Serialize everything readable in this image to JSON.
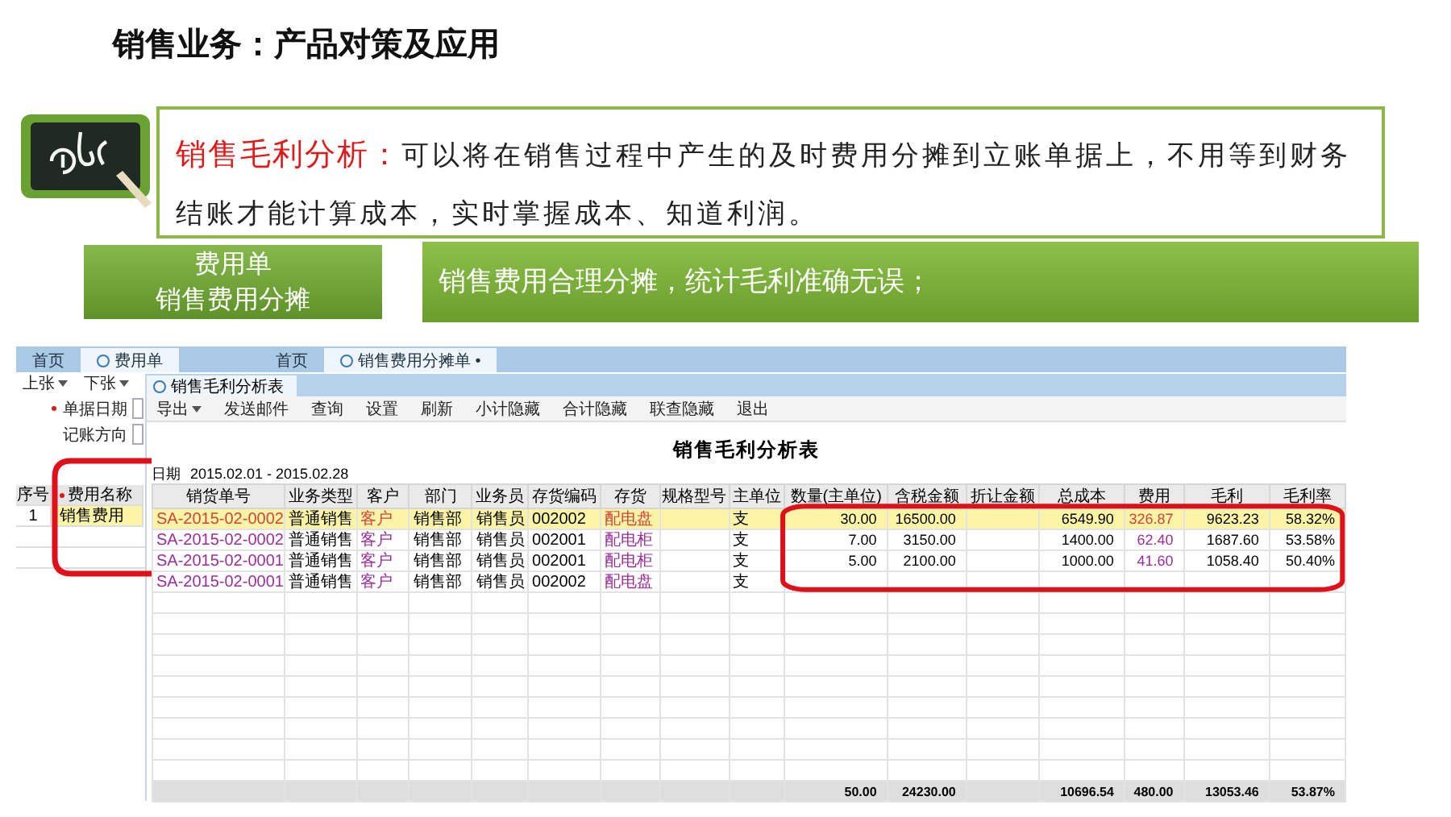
{
  "slide_title": "销售业务：产品对策及应用",
  "intro": {
    "term": "销售毛利分析：",
    "text": "可以将在销售过程中产生的及时费用分摊到立账单据上，不用等到财务结账才能计算成本，实时掌握成本、知道利润。"
  },
  "callouts": [
    {
      "kind": "label",
      "lines": [
        "费用单",
        "销售费用分摊"
      ]
    },
    {
      "kind": "banner",
      "lines": [
        "销售费用合理分摊，统计毛利准确无误；"
      ]
    }
  ],
  "screenshot": {
    "tab_groups": [
      [
        {
          "label": "首页",
          "kind": "home",
          "selected": false
        },
        {
          "label": "费用单",
          "kind": "doc",
          "selected": true
        }
      ],
      [
        {
          "label": "首页",
          "kind": "home",
          "selected": false
        },
        {
          "label": "销售费用分摊单 •",
          "kind": "doc",
          "selected": true
        }
      ]
    ],
    "expense_form": {
      "toolbar": [
        {
          "label": "上张",
          "dropdown": true
        },
        {
          "label": "下张",
          "dropdown": true
        }
      ],
      "fields": [
        {
          "label": "单据日期",
          "required": true
        },
        {
          "label": "记账方向",
          "required": false
        }
      ],
      "columns": [
        {
          "label": "序号",
          "required": false
        },
        {
          "label": "费用名称",
          "required": true
        }
      ],
      "rows": [
        {
          "cells": [
            "1",
            "销售费用"
          ],
          "selected": true
        }
      ]
    },
    "report": {
      "tab": "销售毛利分析表",
      "toolbar": [
        {
          "label": "导出",
          "dropdown": true
        },
        {
          "label": "发送邮件",
          "dropdown": false
        },
        {
          "label": "查询",
          "dropdown": false
        },
        {
          "label": "设置",
          "dropdown": false
        },
        {
          "label": "刷新",
          "dropdown": false
        },
        {
          "label": "小计隐藏",
          "dropdown": false
        },
        {
          "label": "合计隐藏",
          "dropdown": false
        },
        {
          "label": "联查隐藏",
          "dropdown": false
        },
        {
          "label": "退出",
          "dropdown": false
        }
      ],
      "title": "销售毛利分析表",
      "date_label": "日期",
      "date_value": "2015.02.01 - 2015.02.28",
      "columns": [
        {
          "label": "销货单号",
          "kind": "link"
        },
        {
          "label": "业务类型",
          "kind": "text"
        },
        {
          "label": "客户",
          "kind": "link"
        },
        {
          "label": "部门",
          "kind": "text"
        },
        {
          "label": "业务员",
          "kind": "text"
        },
        {
          "label": "存货编码",
          "kind": "text"
        },
        {
          "label": "存货",
          "kind": "link"
        },
        {
          "label": "规格型号",
          "kind": "text"
        },
        {
          "label": "主单位",
          "kind": "text"
        },
        {
          "label": "数量(主单位)",
          "kind": "num",
          "total": "50.00"
        },
        {
          "label": "含税金额",
          "kind": "num",
          "total": "24230.00"
        },
        {
          "label": "折让金额",
          "kind": "num"
        },
        {
          "label": "总成本",
          "kind": "num",
          "total": "10696.54"
        },
        {
          "label": "费用",
          "kind": "numlink",
          "total": "480.00"
        },
        {
          "label": "毛利",
          "kind": "num",
          "total": "13053.46"
        },
        {
          "label": "毛利率",
          "kind": "num",
          "total": "53.87%"
        }
      ],
      "rows": [
        {
          "selected": true,
          "cells": [
            "SA-2015-02-0002",
            "普通销售",
            "客户",
            "销售部",
            "销售员",
            "002002",
            "配电盘",
            "",
            "支",
            "30.00",
            "16500.00",
            "",
            "6549.90",
            "326.87",
            "9623.23",
            "58.32%"
          ]
        },
        {
          "selected": false,
          "cells": [
            "SA-2015-02-0002",
            "普通销售",
            "客户",
            "销售部",
            "销售员",
            "002001",
            "配电柜",
            "",
            "支",
            "7.00",
            "3150.00",
            "",
            "1400.00",
            "62.40",
            "1687.60",
            "53.58%"
          ]
        },
        {
          "selected": false,
          "cells": [
            "SA-2015-02-0001",
            "普通销售",
            "客户",
            "销售部",
            "销售员",
            "002001",
            "配电柜",
            "",
            "支",
            "5.00",
            "2100.00",
            "",
            "1000.00",
            "41.60",
            "1058.40",
            "50.40%"
          ]
        },
        {
          "selected": false,
          "cells": [
            "SA-2015-02-0001",
            "普通销售",
            "客户",
            "销售部",
            "销售员",
            "002002",
            "配电盘",
            "",
            "支"
          ]
        }
      ]
    }
  }
}
